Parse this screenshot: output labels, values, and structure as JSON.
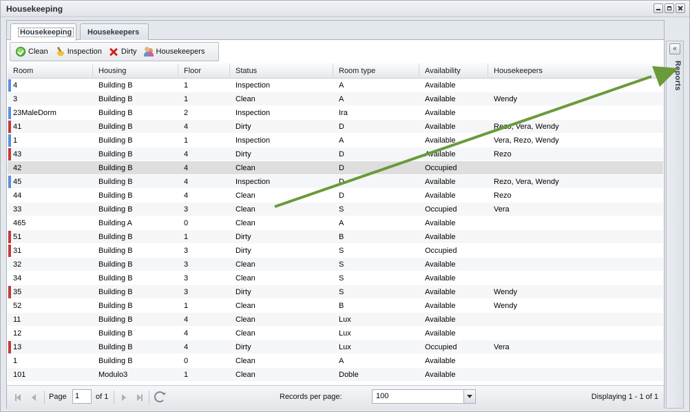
{
  "window": {
    "title": "Housekeeping"
  },
  "tabs": [
    {
      "label": "Housekeeping",
      "active": true
    },
    {
      "label": "Housekeepers",
      "active": false
    }
  ],
  "toolbar": {
    "clean": {
      "label": "Clean",
      "icon": "check-circle-icon"
    },
    "inspection": {
      "label": "Inspection",
      "icon": "broom-icon"
    },
    "dirty": {
      "label": "Dirty",
      "icon": "red-x-icon"
    },
    "housekeepers": {
      "label": "Housekeepers",
      "icon": "people-icon"
    }
  },
  "grid": {
    "columns": [
      "Room",
      "Housing",
      "Floor",
      "Status",
      "Room type",
      "Availability",
      "Housekeepers"
    ],
    "rows": [
      {
        "room": "4",
        "housing": "Building B",
        "floor": "1",
        "status": "Inspection",
        "type": "A",
        "availability": "Available",
        "housekeepers": ""
      },
      {
        "room": "3",
        "housing": "Building B",
        "floor": "1",
        "status": "Clean",
        "type": "A",
        "availability": "Available",
        "housekeepers": "Wendy"
      },
      {
        "room": "23MaleDorm",
        "housing": "Building B",
        "floor": "2",
        "status": "Inspection",
        "type": "Ira",
        "availability": "Available",
        "housekeepers": ""
      },
      {
        "room": "41",
        "housing": "Building B",
        "floor": "4",
        "status": "Dirty",
        "type": "D",
        "availability": "Available",
        "housekeepers": "Rezo, Vera, Wendy"
      },
      {
        "room": "1",
        "housing": "Building B",
        "floor": "1",
        "status": "Inspection",
        "type": "A",
        "availability": "Available",
        "housekeepers": "Vera, Rezo, Wendy"
      },
      {
        "room": "43",
        "housing": "Building B",
        "floor": "4",
        "status": "Dirty",
        "type": "D",
        "availability": "Available",
        "housekeepers": "Rezo"
      },
      {
        "room": "42",
        "housing": "Building B",
        "floor": "4",
        "status": "Clean",
        "type": "D",
        "availability": "Occupied",
        "housekeepers": ""
      },
      {
        "room": "45",
        "housing": "Building B",
        "floor": "4",
        "status": "Inspection",
        "type": "D",
        "availability": "Available",
        "housekeepers": "Rezo, Vera, Wendy"
      },
      {
        "room": "44",
        "housing": "Building B",
        "floor": "4",
        "status": "Clean",
        "type": "D",
        "availability": "Available",
        "housekeepers": "Rezo"
      },
      {
        "room": "33",
        "housing": "Building B",
        "floor": "3",
        "status": "Clean",
        "type": "S",
        "availability": "Occupied",
        "housekeepers": "Vera"
      },
      {
        "room": "465",
        "housing": "Building A",
        "floor": "0",
        "status": "Clean",
        "type": "A",
        "availability": "Available",
        "housekeepers": ""
      },
      {
        "room": "51",
        "housing": "Building B",
        "floor": "1",
        "status": "Dirty",
        "type": "B",
        "availability": "Available",
        "housekeepers": ""
      },
      {
        "room": "31",
        "housing": "Building B",
        "floor": "3",
        "status": "Dirty",
        "type": "S",
        "availability": "Occupied",
        "housekeepers": ""
      },
      {
        "room": "32",
        "housing": "Building B",
        "floor": "3",
        "status": "Clean",
        "type": "S",
        "availability": "Available",
        "housekeepers": ""
      },
      {
        "room": "34",
        "housing": "Building B",
        "floor": "3",
        "status": "Clean",
        "type": "S",
        "availability": "Available",
        "housekeepers": ""
      },
      {
        "room": "35",
        "housing": "Building B",
        "floor": "3",
        "status": "Dirty",
        "type": "S",
        "availability": "Available",
        "housekeepers": "Wendy"
      },
      {
        "room": "52",
        "housing": "Building B",
        "floor": "1",
        "status": "Clean",
        "type": "B",
        "availability": "Available",
        "housekeepers": "Wendy"
      },
      {
        "room": "11",
        "housing": "Building B",
        "floor": "4",
        "status": "Clean",
        "type": "Lux",
        "availability": "Available",
        "housekeepers": ""
      },
      {
        "room": "12",
        "housing": "Building B",
        "floor": "4",
        "status": "Clean",
        "type": "Lux",
        "availability": "Available",
        "housekeepers": ""
      },
      {
        "room": "13",
        "housing": "Building B",
        "floor": "4",
        "status": "Dirty",
        "type": "Lux",
        "availability": "Occupied",
        "housekeepers": "Vera"
      },
      {
        "room": "1",
        "housing": "Building B",
        "floor": "0",
        "status": "Clean",
        "type": "A",
        "availability": "Available",
        "housekeepers": ""
      },
      {
        "room": "101",
        "housing": "Modulo3",
        "floor": "1",
        "status": "Clean",
        "type": "Doble",
        "availability": "Available",
        "housekeepers": ""
      }
    ],
    "selected_room_index": 6
  },
  "pager": {
    "page_label": "Page",
    "page_value": "1",
    "of_label": "of 1",
    "records_per_page_label": "Records per page:",
    "records_per_page_value": "100",
    "displaying": "Displaying 1 - 1 of 1"
  },
  "side_panel": {
    "label": "Reports"
  },
  "colors": {
    "inspection_marker": "#5b8fe0",
    "dirty_marker": "#c63a3a",
    "annotation_arrow": "#6a9a3a"
  }
}
